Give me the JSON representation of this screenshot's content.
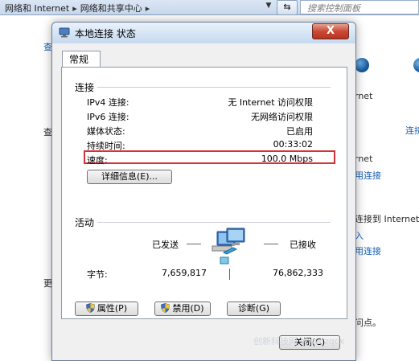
{
  "explorer": {
    "breadcrumb": [
      "网络和 Internet",
      "网络和共享中心"
    ],
    "search_placeholder": "搜索控制面板",
    "bg_left": [
      "查",
      "查",
      "更"
    ],
    "bg_right": [
      "rnet",
      "连接",
      "rnet",
      "用连接",
      "连接到 Internet",
      "入",
      "用连接",
      "问点。"
    ]
  },
  "dialog": {
    "title": "本地连接 状态",
    "close_label": "X",
    "tab_label": "常规",
    "connection_header": "连接",
    "rows": [
      {
        "label": "IPv4 连接:",
        "value": "无 Internet 访问权限"
      },
      {
        "label": "IPv6 连接:",
        "value": "无网络访问权限"
      },
      {
        "label": "媒体状态:",
        "value": "已启用"
      },
      {
        "label": "持续时间:",
        "value": "00:33:02"
      },
      {
        "label": "速度:",
        "value": "100.0 Mbps"
      }
    ],
    "details_button": "详细信息(E)...",
    "activity_header": "活动",
    "sent_label": "已发送",
    "received_label": "已接收",
    "bytes_label": "字节:",
    "bytes_sent": "7,659,817",
    "bytes_received": "76,862,333",
    "properties_button": "属性(P)",
    "disable_button": "禁用(D)",
    "diagnose_button": "诊断(G)",
    "close_button": "关闭(C)"
  },
  "watermark": "创新科技网 www.zqcx"
}
